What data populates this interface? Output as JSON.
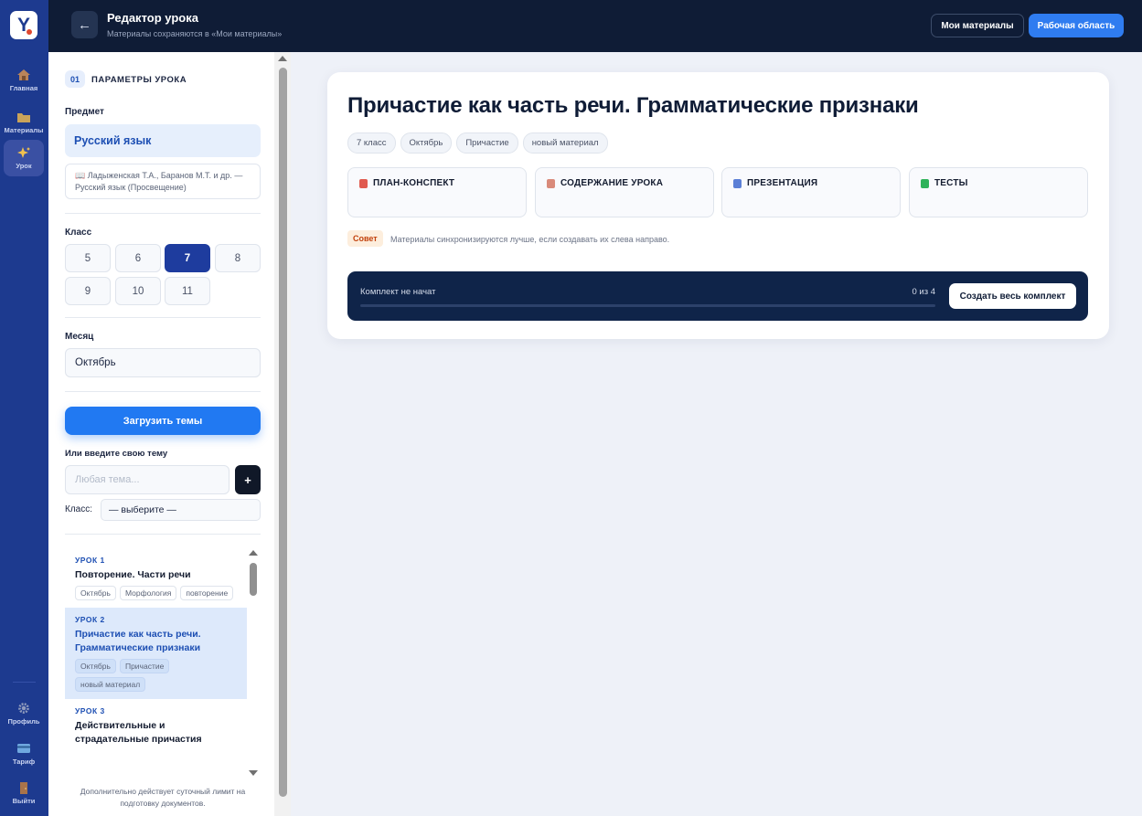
{
  "rail": {
    "logo": "Y",
    "items": [
      {
        "label": "Главная",
        "icon": "home-icon"
      },
      {
        "label": "Материалы",
        "icon": "folder-icon"
      },
      {
        "label": "Урок",
        "icon": "sparkles-icon"
      },
      {
        "label": "Профиль",
        "icon": "gear-icon"
      },
      {
        "label": "Тариф",
        "icon": "credit-card-icon"
      },
      {
        "label": "Выйти",
        "icon": "door-icon"
      }
    ]
  },
  "header": {
    "back_icon": "←",
    "title": "Редактор урока",
    "subtitle": "Материалы сохраняются в «Мои материалы»",
    "my_materials": "Мои материалы",
    "workspace": "Рабочая область"
  },
  "params": {
    "step": "01",
    "step_title": "ПАРАМЕТРЫ УРОКА",
    "subject_label": "Предмет",
    "subject": "Русский язык",
    "textbook": "📖 Ладыженская Т.А., Баранов М.Т. и др. — Русский язык (Просвещение)",
    "grade_label": "Класс",
    "grades": [
      "5",
      "6",
      "7",
      "8",
      "9",
      "10",
      "11"
    ],
    "grade_selected": "7",
    "month_label": "Месяц",
    "month": "Октябрь",
    "load_button": "Загрузить темы",
    "own_topic_label": "Или введите свою тему",
    "own_topic_placeholder": "Любая тема...",
    "add_button": "+",
    "class_label": "Класс:",
    "class_select": "— выберите —",
    "limit_note": "Дополнительно действует суточный лимит на подготовку документов."
  },
  "lessons": [
    {
      "num": "УРОК 1",
      "title": "Повторение. Части речи",
      "tags": [
        "Октябрь",
        "Морфология",
        "повторение"
      ],
      "selected": false
    },
    {
      "num": "УРОК 2",
      "title": "Причастие как часть речи. Грамматические признаки",
      "tags": [
        "Октябрь",
        "Причастие",
        "новый материал"
      ],
      "selected": true
    },
    {
      "num": "УРОК 3",
      "title": "Действительные и страдательные причастия",
      "tags": [],
      "selected": false
    }
  ],
  "main": {
    "title": "Причастие как часть речи. Грамматические признаки",
    "chips": [
      "7 класс",
      "Октябрь",
      "Причастие",
      "новый материал"
    ],
    "tiles": [
      {
        "label": "ПЛАН-КОНСПЕКТ",
        "icon": "document-icon",
        "color": "#e05a4f"
      },
      {
        "label": "СОДЕРЖАНИЕ УРОКА",
        "icon": "book-icon",
        "color": "#d98a7a"
      },
      {
        "label": "ПРЕЗЕНТАЦИЯ",
        "icon": "bar-chart-icon",
        "color": "#5b7fd6"
      },
      {
        "label": "ТЕСТЫ",
        "icon": "check-icon",
        "color": "#2fb35a"
      }
    ],
    "tip_badge": "Совет",
    "tip_text": "Материалы синхронизируются лучше, если создавать их слева направо.",
    "kit_status": "Комплект не начат",
    "kit_count": "0 из 4",
    "kit_progress": 0,
    "kit_button": "Создать весь комплект"
  },
  "colors": {
    "rail": "#1d3a8f",
    "header": "#0f1c36",
    "accent": "#2f7cf0",
    "grade_selected": "#1e3c9e",
    "kit_panel": "#0f2449"
  }
}
